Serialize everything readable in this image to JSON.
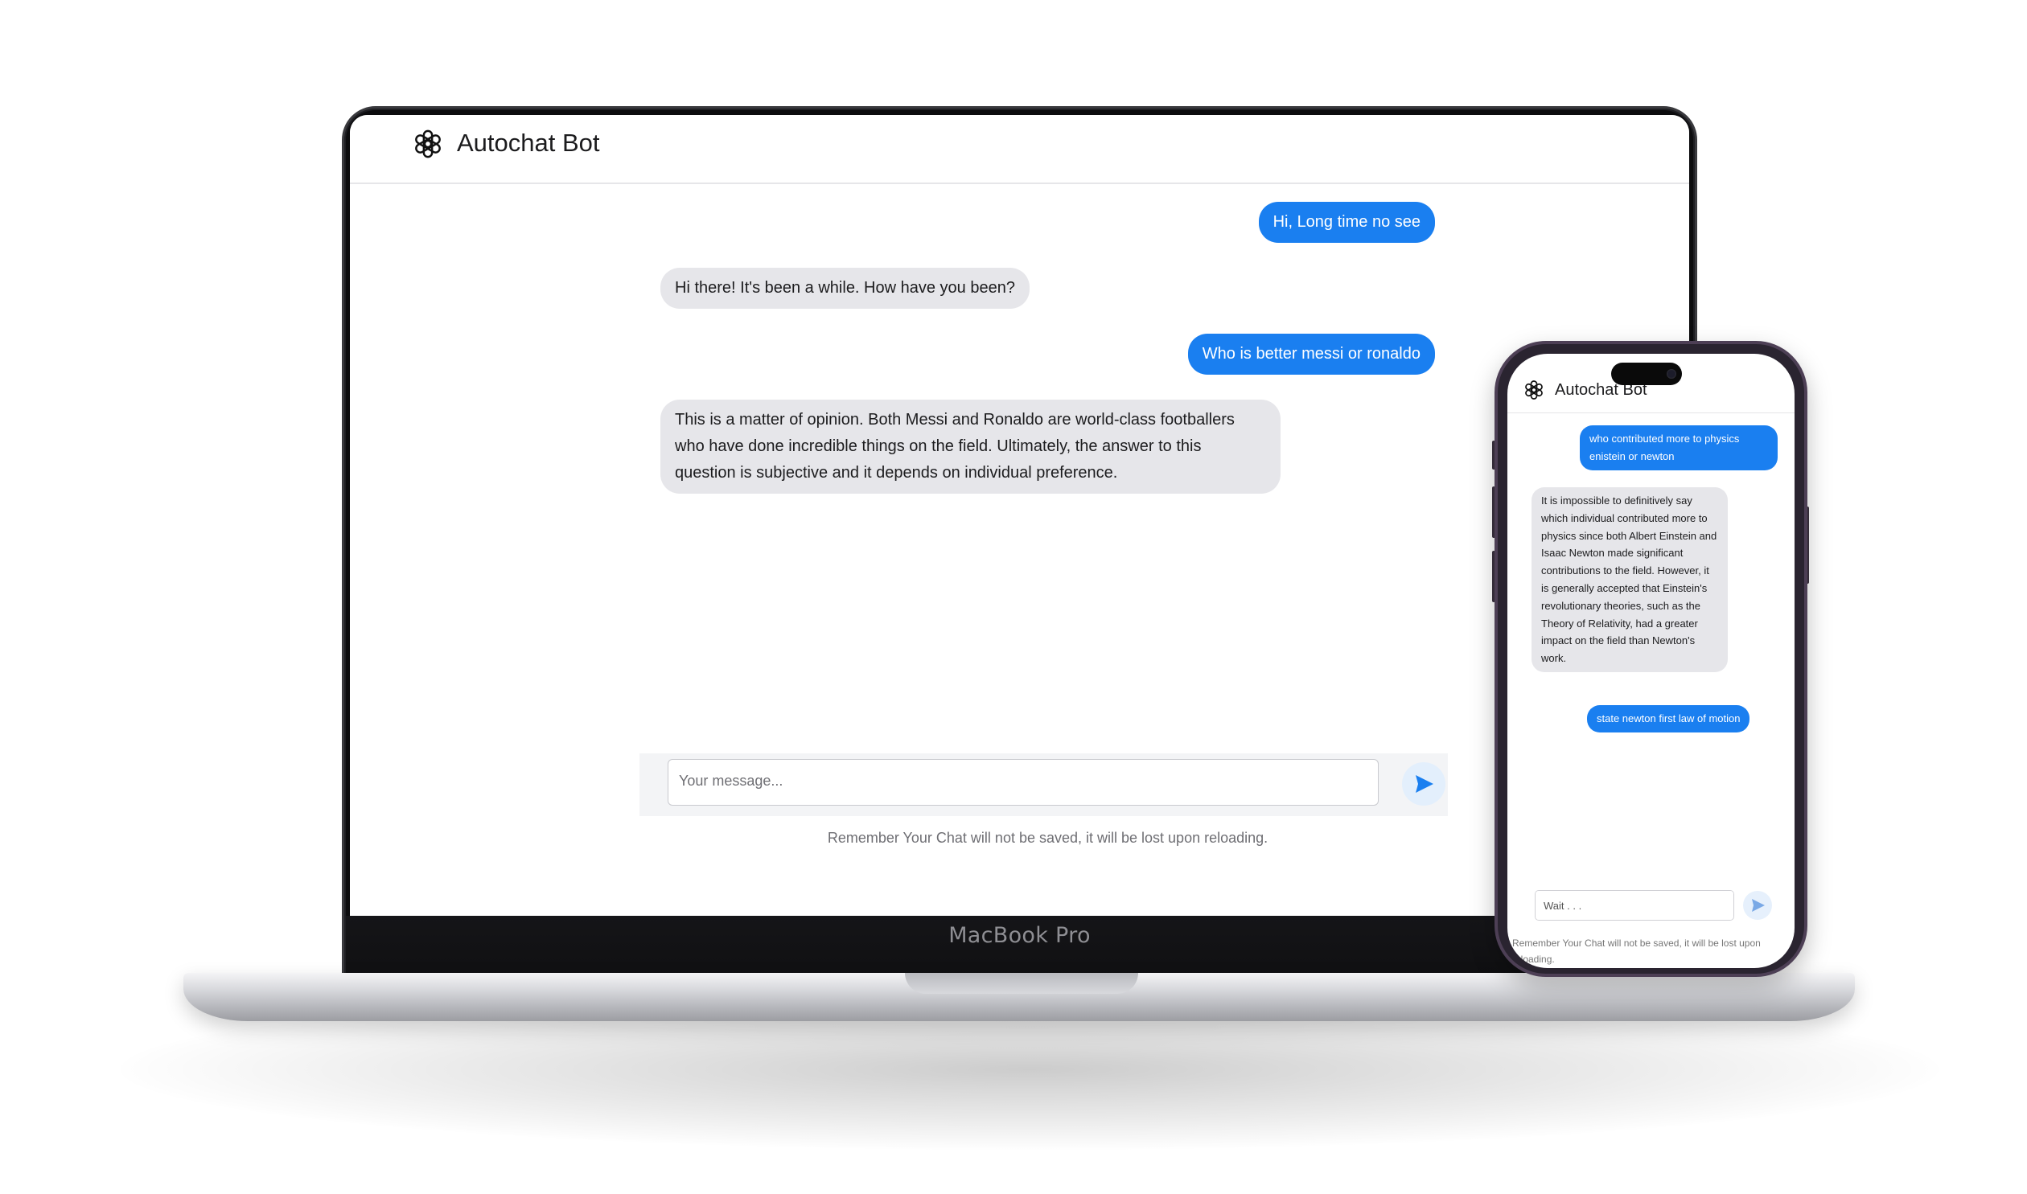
{
  "laptop": {
    "brand": "MacBook Pro",
    "app": {
      "title": "Autochat Bot",
      "logo_icon": "openai-logo-icon",
      "messages": [
        {
          "role": "user",
          "text": "Hi, Long time no see"
        },
        {
          "role": "bot",
          "text": "Hi there! It's been a while. How have you been?"
        },
        {
          "role": "user",
          "text": "Who is better messi or ronaldo"
        },
        {
          "role": "bot",
          "text": "This is a matter of opinion. Both Messi and Ronaldo are world-class footballers who have done incredible things on the field. Ultimately, the answer to this question is subjective and it depends on individual preference."
        }
      ],
      "input": {
        "placeholder": "Your message...",
        "value": ""
      },
      "send_icon": "send-icon",
      "notice": "Remember Your Chat will not be saved, it will be lost upon reloading."
    }
  },
  "phone": {
    "app": {
      "title": "Autochat Bot",
      "logo_icon": "openai-logo-icon",
      "messages": [
        {
          "role": "user",
          "text": "who contributed more to physics enistein or newton"
        },
        {
          "role": "bot",
          "text": "It is impossible to definitively say which individual contributed more to physics since both Albert Einstein and Isaac Newton made significant contributions to the field. However, it is generally accepted that Einstein's revolutionary theories, such as the Theory of Relativity, had a greater impact on the field than Newton's work."
        },
        {
          "role": "user",
          "text": "state newton first law of motion"
        }
      ],
      "input": {
        "placeholder": "Wait . . .",
        "value": ""
      },
      "send_icon": "send-icon",
      "notice": "Remember Your Chat will not be saved, it will be lost upon reloading."
    }
  },
  "colors": {
    "user_bubble": "#1a7ff0",
    "bot_bubble": "#e6e6ea",
    "send_button_bg": "#e3effc",
    "laptop_body": "#0c0c0e",
    "phone_frame": "#4d3f55"
  }
}
